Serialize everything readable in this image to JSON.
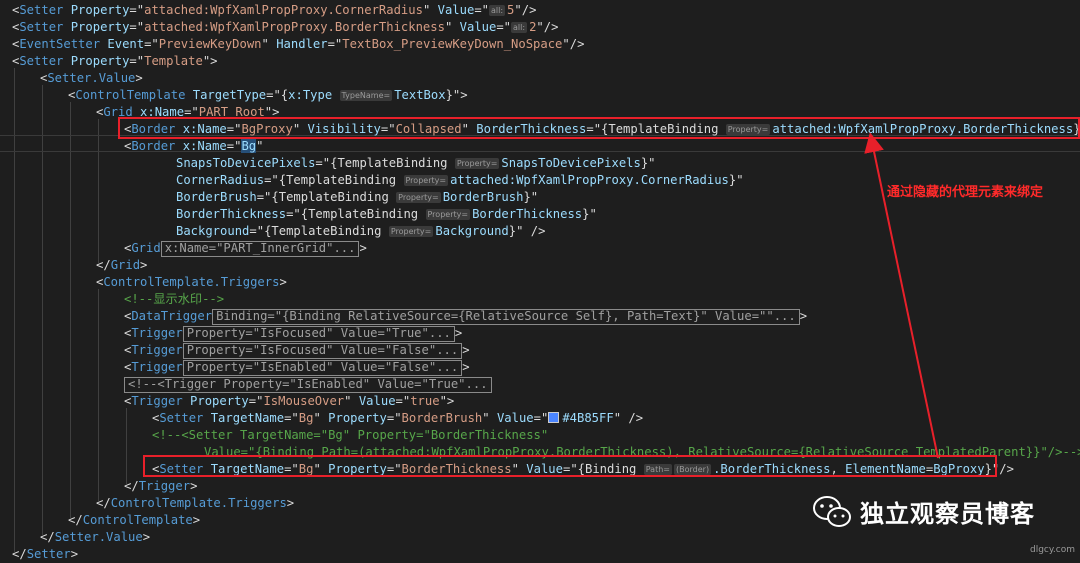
{
  "lines": [
    {
      "id": "l1",
      "parts": [
        [
          "p",
          "<"
        ],
        [
          "t",
          "Setter "
        ],
        [
          "a",
          "Property"
        ],
        [
          "p",
          "=\""
        ],
        [
          "v",
          "attached:WpfXamlPropProxy.CornerRadius"
        ],
        [
          "p",
          "\" "
        ],
        [
          "a",
          "Value"
        ],
        [
          "p",
          "=\""
        ],
        [
          "h",
          "all:"
        ],
        [
          "v",
          "5"
        ],
        [
          "p",
          "\"/>"
        ]
      ]
    },
    {
      "id": "l2",
      "parts": [
        [
          "p",
          "<"
        ],
        [
          "t",
          "Setter "
        ],
        [
          "a",
          "Property"
        ],
        [
          "p",
          "=\""
        ],
        [
          "v",
          "attached:WpfXamlPropProxy.BorderThickness"
        ],
        [
          "p",
          "\" "
        ],
        [
          "a",
          "Value"
        ],
        [
          "p",
          "=\""
        ],
        [
          "h",
          "all:"
        ],
        [
          "v",
          "2"
        ],
        [
          "p",
          "\"/>"
        ]
      ]
    },
    {
      "id": "l3",
      "parts": [
        [
          "p",
          "<"
        ],
        [
          "t",
          "EventSetter "
        ],
        [
          "a",
          "Event"
        ],
        [
          "p",
          "=\""
        ],
        [
          "v",
          "PreviewKeyDown"
        ],
        [
          "p",
          "\" "
        ],
        [
          "a",
          "Handler"
        ],
        [
          "p",
          "=\""
        ],
        [
          "v",
          "TextBox_PreviewKeyDown_NoSpace"
        ],
        [
          "p",
          "\"/>"
        ]
      ]
    },
    {
      "id": "l4",
      "parts": [
        [
          "p",
          "<"
        ],
        [
          "t",
          "Setter "
        ],
        [
          "a",
          "Property"
        ],
        [
          "p",
          "=\""
        ],
        [
          "v",
          "Template"
        ],
        [
          "p",
          "\">"
        ]
      ]
    },
    {
      "id": "l5",
      "parts": [
        [
          "p",
          "<"
        ],
        [
          "t",
          "Setter.Value"
        ],
        [
          "p",
          ">"
        ]
      ]
    },
    {
      "id": "l6",
      "parts": [
        [
          "p",
          "<"
        ],
        [
          "t",
          "ControlTemplate "
        ],
        [
          "a",
          "TargetType"
        ],
        [
          "p",
          "=\"{"
        ],
        [
          "a",
          "x:Type "
        ],
        [
          "h",
          "TypeName="
        ],
        [
          "a",
          "TextBox"
        ],
        [
          "p",
          "}\">"
        ]
      ]
    },
    {
      "id": "l7",
      "parts": [
        [
          "p",
          "<"
        ],
        [
          "t",
          "Grid "
        ],
        [
          "a",
          "x:Name"
        ],
        [
          "p",
          "=\""
        ],
        [
          "v",
          "PART_Root"
        ],
        [
          "p",
          "\">"
        ]
      ]
    },
    {
      "id": "l8",
      "parts": [
        [
          "p",
          "<"
        ],
        [
          "t",
          "Border "
        ],
        [
          "a",
          "x:Name"
        ],
        [
          "p",
          "=\""
        ],
        [
          "v",
          "BgProxy"
        ],
        [
          "p",
          "\" "
        ],
        [
          "a",
          "Visibility"
        ],
        [
          "p",
          "=\""
        ],
        [
          "v",
          "Collapsed"
        ],
        [
          "p",
          "\" "
        ],
        [
          "a",
          "BorderThickness"
        ],
        [
          "p",
          "=\""
        ],
        [
          "p",
          "{TemplateBinding "
        ],
        [
          "h",
          "Property="
        ],
        [
          "a",
          "attached:WpfXamlPropProxy.BorderThickness"
        ],
        [
          "p",
          "}\"/>"
        ]
      ]
    },
    {
      "id": "l9",
      "parts": [
        [
          "p",
          "<"
        ],
        [
          "t",
          "Border "
        ],
        [
          "a",
          "x:Name"
        ],
        [
          "p",
          "=\""
        ],
        [
          "s",
          "Bg"
        ],
        [
          "p",
          "\""
        ]
      ]
    },
    {
      "id": "l10",
      "parts": [
        [
          "a",
          "SnapsToDevicePixels"
        ],
        [
          "p",
          "=\""
        ],
        [
          "p",
          "{TemplateBinding "
        ],
        [
          "h",
          "Property="
        ],
        [
          "a",
          "SnapsToDevicePixels"
        ],
        [
          "p",
          "}\""
        ]
      ]
    },
    {
      "id": "l11",
      "parts": [
        [
          "a",
          "CornerRadius"
        ],
        [
          "p",
          "=\""
        ],
        [
          "p",
          "{TemplateBinding "
        ],
        [
          "h",
          "Property="
        ],
        [
          "a",
          "attached:WpfXamlPropProxy.CornerRadius"
        ],
        [
          "p",
          "}\""
        ]
      ]
    },
    {
      "id": "l12",
      "parts": [
        [
          "a",
          "BorderBrush"
        ],
        [
          "p",
          "=\""
        ],
        [
          "p",
          "{TemplateBinding "
        ],
        [
          "h",
          "Property="
        ],
        [
          "a",
          "BorderBrush"
        ],
        [
          "p",
          "}\""
        ]
      ]
    },
    {
      "id": "l13",
      "parts": [
        [
          "a",
          "BorderThickness"
        ],
        [
          "p",
          "=\""
        ],
        [
          "p",
          "{TemplateBinding "
        ],
        [
          "h",
          "Property="
        ],
        [
          "a",
          "BorderThickness"
        ],
        [
          "p",
          "}\""
        ]
      ]
    },
    {
      "id": "l14",
      "parts": [
        [
          "a",
          "Background"
        ],
        [
          "p",
          "=\""
        ],
        [
          "p",
          "{TemplateBinding "
        ],
        [
          "h",
          "Property="
        ],
        [
          "a",
          "Background"
        ],
        [
          "p",
          "}\" />"
        ]
      ]
    },
    {
      "id": "l15",
      "parts": [
        [
          "p",
          "<"
        ],
        [
          "t",
          "Grid"
        ],
        [
          "f",
          "x:Name=\"PART_InnerGrid\"..."
        ],
        [
          "p",
          ">"
        ]
      ]
    },
    {
      "id": "l16",
      "parts": [
        [
          "p",
          "</"
        ],
        [
          "t",
          "Grid"
        ],
        [
          "p",
          ">"
        ]
      ]
    },
    {
      "id": "l17",
      "parts": [
        [
          "p",
          "<"
        ],
        [
          "t",
          "ControlTemplate.Triggers"
        ],
        [
          "p",
          ">"
        ]
      ]
    },
    {
      "id": "l18",
      "parts": [
        [
          "c",
          "<!--显示水印-->"
        ]
      ]
    },
    {
      "id": "l19",
      "parts": [
        [
          "p",
          "<"
        ],
        [
          "t",
          "DataTrigger"
        ],
        [
          "f",
          "Binding=\"{Binding RelativeSource={RelativeSource Self}, Path=Text}\" Value=\"\"..."
        ],
        [
          "p",
          ">"
        ]
      ]
    },
    {
      "id": "l20",
      "parts": [
        [
          "p",
          "<"
        ],
        [
          "t",
          "Trigger"
        ],
        [
          "f",
          "Property=\"IsFocused\" Value=\"True\"..."
        ],
        [
          "p",
          ">"
        ]
      ]
    },
    {
      "id": "l21",
      "parts": [
        [
          "p",
          "<"
        ],
        [
          "t",
          "Trigger"
        ],
        [
          "f",
          "Property=\"IsFocused\" Value=\"False\"..."
        ],
        [
          "p",
          ">"
        ]
      ]
    },
    {
      "id": "l22",
      "parts": [
        [
          "p",
          "<"
        ],
        [
          "t",
          "Trigger"
        ],
        [
          "f",
          "Property=\"IsEnabled\" Value=\"False\"..."
        ],
        [
          "p",
          ">"
        ]
      ]
    },
    {
      "id": "l23",
      "parts": [
        [
          "fc",
          "<!--<Trigger Property=\"IsEnabled\" Value=\"True\"..."
        ]
      ]
    },
    {
      "id": "l24",
      "parts": [
        [
          "p",
          "<"
        ],
        [
          "t",
          "Trigger "
        ],
        [
          "a",
          "Property"
        ],
        [
          "p",
          "=\""
        ],
        [
          "v",
          "IsMouseOver"
        ],
        [
          "p",
          "\" "
        ],
        [
          "a",
          "Value"
        ],
        [
          "p",
          "=\""
        ],
        [
          "v",
          "true"
        ],
        [
          "p",
          "\">"
        ]
      ]
    },
    {
      "id": "l25",
      "parts": [
        [
          "p",
          "<"
        ],
        [
          "t",
          "Setter "
        ],
        [
          "a",
          "TargetName"
        ],
        [
          "p",
          "=\""
        ],
        [
          "v",
          "Bg"
        ],
        [
          "p",
          "\" "
        ],
        [
          "a",
          "Property"
        ],
        [
          "p",
          "=\""
        ],
        [
          "v",
          "BorderBrush"
        ],
        [
          "p",
          "\" "
        ],
        [
          "a",
          "Value"
        ],
        [
          "p",
          "=\""
        ],
        [
          "w",
          ""
        ],
        [
          "a",
          "#4B85FF"
        ],
        [
          "p",
          "\" />"
        ]
      ]
    },
    {
      "id": "l26",
      "parts": [
        [
          "c",
          "<!--<Setter TargetName=\"Bg\" Property=\"BorderThickness\""
        ]
      ]
    },
    {
      "id": "l27",
      "parts": [
        [
          "c",
          "Value=\"{Binding Path=(attached:WpfXamlPropProxy.BorderThickness), RelativeSource={RelativeSource TemplatedParent}}\"/>-->"
        ]
      ]
    },
    {
      "id": "l28",
      "parts": [
        [
          "p",
          "<"
        ],
        [
          "t",
          "Setter "
        ],
        [
          "a",
          "TargetName"
        ],
        [
          "p",
          "=\""
        ],
        [
          "v",
          "Bg"
        ],
        [
          "p",
          "\" "
        ],
        [
          "a",
          "Property"
        ],
        [
          "p",
          "=\""
        ],
        [
          "v",
          "BorderThickness"
        ],
        [
          "p",
          "\" "
        ],
        [
          "a",
          "Value"
        ],
        [
          "p",
          "=\""
        ],
        [
          "p",
          "{Binding "
        ],
        [
          "h",
          "Path="
        ],
        [
          "h",
          "(Border)"
        ],
        [
          "a",
          ".BorderThickness"
        ],
        [
          "p",
          ", "
        ],
        [
          "a",
          "ElementName"
        ],
        [
          "p",
          "="
        ],
        [
          "a",
          "BgProxy"
        ],
        [
          "p",
          "}\"/>"
        ]
      ]
    },
    {
      "id": "l29",
      "parts": [
        [
          "p",
          "</"
        ],
        [
          "t",
          "Trigger"
        ],
        [
          "p",
          ">"
        ]
      ]
    },
    {
      "id": "l30",
      "parts": [
        [
          "p",
          "</"
        ],
        [
          "t",
          "ControlTemplate.Triggers"
        ],
        [
          "p",
          ">"
        ]
      ]
    },
    {
      "id": "l31",
      "parts": [
        [
          "p",
          "</"
        ],
        [
          "t",
          "ControlTemplate"
        ],
        [
          "p",
          ">"
        ]
      ]
    },
    {
      "id": "l32",
      "parts": [
        [
          "p",
          "</"
        ],
        [
          "t",
          "Setter.Value"
        ],
        [
          "p",
          ">"
        ]
      ]
    },
    {
      "id": "l33",
      "parts": [
        [
          "p",
          "</"
        ],
        [
          "t",
          "Setter"
        ],
        [
          "p",
          ">"
        ]
      ]
    }
  ],
  "callout": {
    "text": "通过隐藏的代理元素来绑定"
  },
  "brand": {
    "name": "独立观察员博客",
    "icon": "wechat-icon"
  },
  "site": {
    "text": "dlgcy.com"
  },
  "colors": {
    "highlight": "#e8202a",
    "swatch": "#4B85FF"
  }
}
